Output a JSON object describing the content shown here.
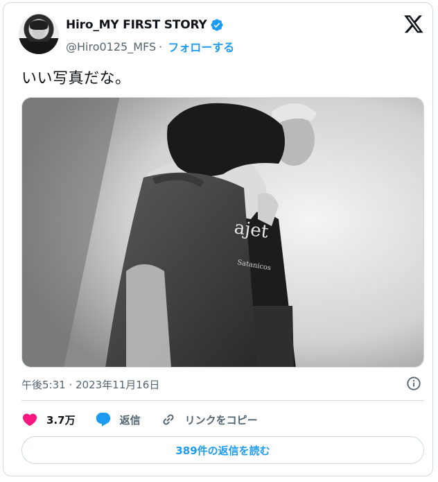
{
  "author": {
    "display_name": "Hiro_MY FIRST STORY",
    "handle": "@Hiro0125_MFS",
    "separator": "·",
    "follow_label": "フォローする",
    "verified": true
  },
  "tweet": {
    "text": "いい写真だな。",
    "timestamp": "午後5:31 · 2023年11月16日"
  },
  "actions": {
    "like_count": "3.7万",
    "reply_label": "返信",
    "copy_link_label": "リンクをコピー"
  },
  "replies_button_label": "389件の返信を読む",
  "colors": {
    "accent": "#1d9bf0",
    "like": "#f91880",
    "muted_text": "#536471",
    "border": "#cfd9de"
  },
  "icons": [
    "x-logo-icon",
    "verified-badge-icon",
    "info-icon",
    "heart-icon",
    "reply-bubble-icon",
    "link-icon"
  ]
}
